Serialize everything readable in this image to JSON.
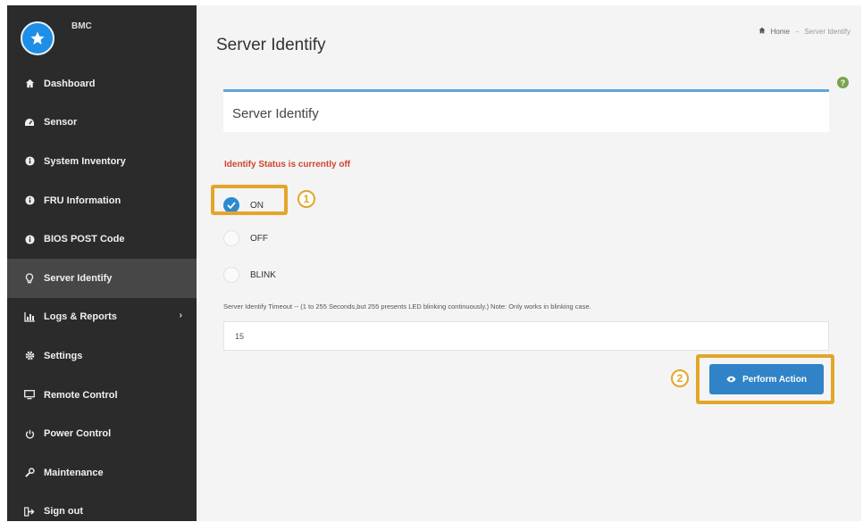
{
  "brand": {
    "name": "BMC"
  },
  "sidebar": {
    "items": [
      {
        "label": "Dashboard",
        "icon": "home-icon"
      },
      {
        "label": "Sensor",
        "icon": "dashboard-gauge-icon"
      },
      {
        "label": "System Inventory",
        "icon": "info-circle-icon"
      },
      {
        "label": "FRU Information",
        "icon": "info-circle-icon"
      },
      {
        "label": "BIOS POST Code",
        "icon": "info-circle-icon"
      },
      {
        "label": "Server Identify",
        "icon": "lightbulb-icon",
        "active": true
      },
      {
        "label": "Logs & Reports",
        "icon": "bar-chart-icon",
        "has_submenu": true
      },
      {
        "label": "Settings",
        "icon": "gear-icon"
      },
      {
        "label": "Remote Control",
        "icon": "monitor-icon"
      },
      {
        "label": "Power Control",
        "icon": "power-icon"
      },
      {
        "label": "Maintenance",
        "icon": "wrench-icon"
      },
      {
        "label": "Sign out",
        "icon": "sign-out-icon"
      }
    ],
    "caret": "›"
  },
  "header": {
    "title": "Server Identify",
    "breadcrumb": {
      "home": "Home",
      "separator": "–",
      "current": "Server Identify"
    }
  },
  "panel": {
    "title": "Server Identify"
  },
  "status_text": "Identify Status is currently off",
  "options": [
    {
      "label": "ON",
      "checked": true
    },
    {
      "label": "OFF",
      "checked": false
    },
    {
      "label": "BLINK",
      "checked": false
    }
  ],
  "timeout": {
    "label": "Server Identify Timeout -- (1 to 255 Seconds,but 255 presents LED blinking continuously.) Note: Only works in blinking case.",
    "value": "15"
  },
  "perform_button": {
    "label": "Perform Action"
  },
  "callouts": {
    "first": "1",
    "second": "2"
  },
  "colors": {
    "accent": "#e3a62a",
    "primary": "#2f83c6",
    "sidebar": "#2b2b2b",
    "status": "#d0452e"
  }
}
